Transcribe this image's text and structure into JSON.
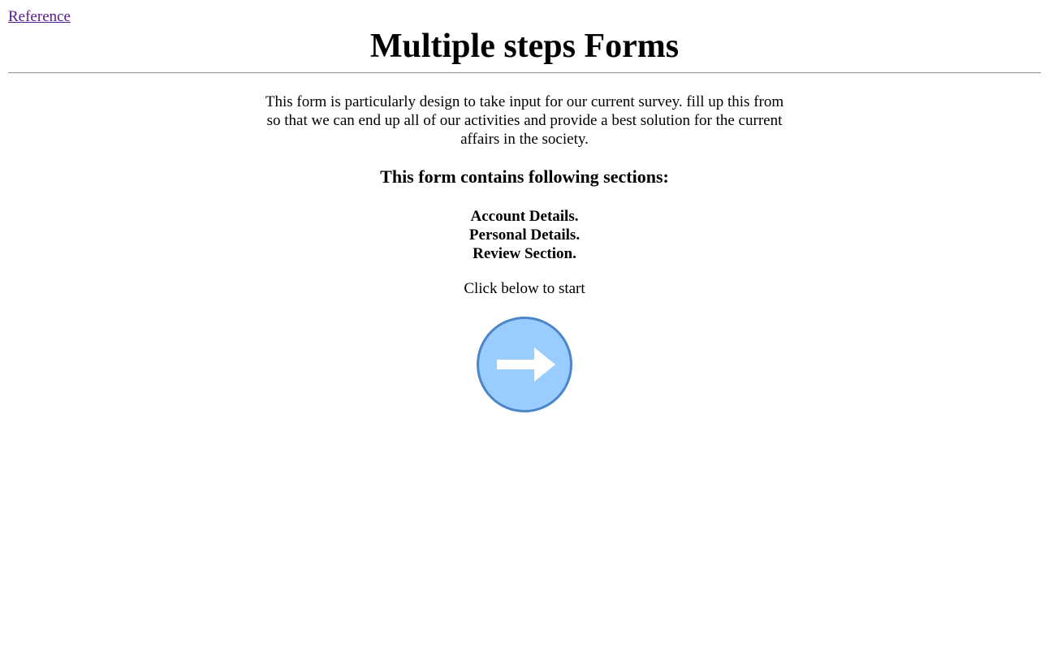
{
  "header": {
    "reference_link": "Reference",
    "title": "Multiple steps Forms"
  },
  "intro": {
    "text": "This form is particularly design to take input for our current survey. fill up this from so that we can end up all of our activities and provide a best solution for the current affairs in the society."
  },
  "sections": {
    "heading": "This form contains following sections:",
    "items": [
      "Account Details.",
      "Personal Details.",
      "Review Section."
    ]
  },
  "start": {
    "prompt": "Click below to start",
    "button_icon": "arrow-right-icon"
  },
  "colors": {
    "link": "#551a8b",
    "button_fill": "#99ccff",
    "button_border": "#4a86c8",
    "arrow": "#ffffff",
    "divider": "#9a9a9a"
  }
}
